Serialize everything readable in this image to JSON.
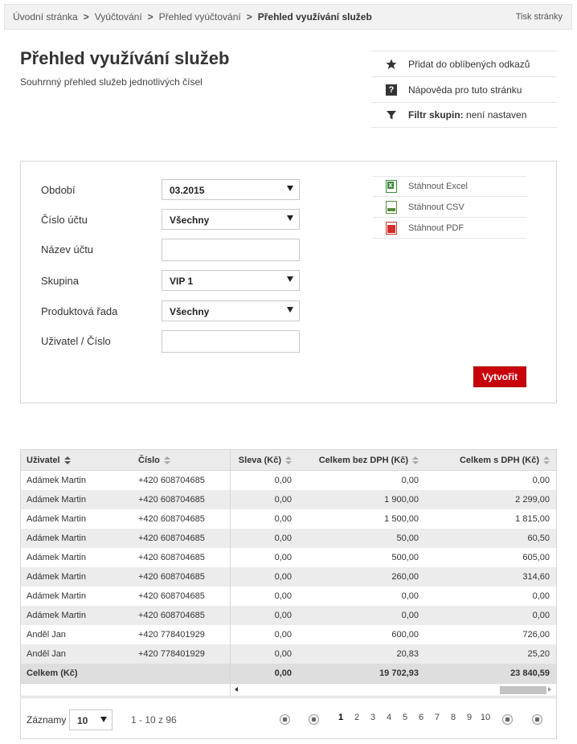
{
  "breadcrumb": {
    "items": [
      "Úvodní stránka",
      "Vyúčtování",
      "Přehled vyúčtování"
    ],
    "current": "Přehled využívání služeb",
    "separator": ">"
  },
  "print_link": "Tisk stránky",
  "page": {
    "title": "Přehled využívání služeb",
    "subtitle": "Souhrnný přehled služeb jednotlivých čísel"
  },
  "quick_links": {
    "favorite": "Přidat do oblíbených odkazů",
    "help": "Nápověda pro tuto stránku",
    "filter_label": "Filtr skupin:",
    "filter_value": "není nastaven"
  },
  "filters": {
    "period_label": "Období",
    "period_value": "03.2015",
    "account_no_label": "Číslo účtu",
    "account_no_value": "Všechny",
    "account_name_label": "Název účtu",
    "account_name_value": "",
    "group_label": "Skupina",
    "group_value": "VIP 1",
    "product_label": "Produktová řada",
    "product_value": "Všechny",
    "user_label": "Uživatel / Číslo",
    "user_value": ""
  },
  "downloads": {
    "excel": "Stáhnout Excel",
    "csv": "Stáhnout CSV",
    "pdf": "Stáhnout PDF"
  },
  "create_button": "Vytvořit",
  "table": {
    "headers": {
      "user": "Uživatel",
      "number": "Číslo",
      "discount": "Sleva (Kč)",
      "total_ex_vat": "Celkem bez DPH (Kč)",
      "total_inc_vat": "Celkem s DPH (Kč)"
    },
    "rows": [
      [
        "Adámek Martin",
        "+420 608704685",
        "0,00",
        "0,00",
        "0,00"
      ],
      [
        "Adámek Martin",
        "+420 608704685",
        "0,00",
        "1 900,00",
        "2 299,00"
      ],
      [
        "Adámek Martin",
        "+420 608704685",
        "0,00",
        "1 500,00",
        "1 815,00"
      ],
      [
        "Adámek Martin",
        "+420 608704685",
        "0,00",
        "50,00",
        "60,50"
      ],
      [
        "Adámek Martin",
        "+420 608704685",
        "0,00",
        "500,00",
        "605,00"
      ],
      [
        "Adámek Martin",
        "+420 608704685",
        "0,00",
        "260,00",
        "314,60"
      ],
      [
        "Adámek Martin",
        "+420 608704685",
        "0,00",
        "0,00",
        "0,00"
      ],
      [
        "Adámek Martin",
        "+420 608704685",
        "0,00",
        "0,00",
        "0,00"
      ],
      [
        "Anděl Jan",
        "+420 778401929",
        "0,00",
        "600,00",
        "726,00"
      ],
      [
        "Anděl Jan",
        "+420 778401929",
        "0,00",
        "20,83",
        "25,20"
      ]
    ],
    "total": {
      "label": "Celkem (Kč)",
      "discount": "0,00",
      "total_ex_vat": "19 702,93",
      "total_inc_vat": "23 840,59"
    }
  },
  "pager": {
    "records_label": "Záznamy",
    "page_size": "10",
    "range": "1 - 10 z 96",
    "pages": [
      "1",
      "2",
      "3",
      "4",
      "5",
      "6",
      "7",
      "8",
      "9",
      "10"
    ],
    "current_page": "1"
  },
  "colors": {
    "accent": "#c8000b",
    "header_bg": "#ebebeb",
    "alt_row": "#ececec"
  }
}
